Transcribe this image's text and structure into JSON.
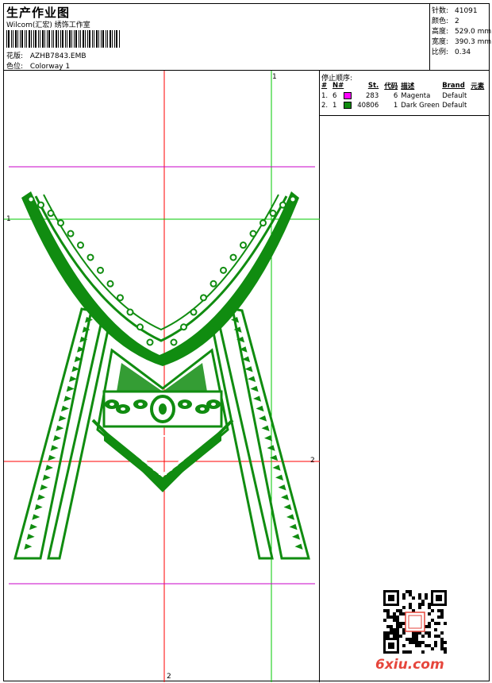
{
  "header": {
    "title": "生产作业图",
    "studio": "Wilcom(汇宏) 绣饰工作室",
    "pattern_label": "花版:",
    "pattern_value": "AZHB7843.EMB",
    "colorway_label": "色位:",
    "colorway_value": "Colorway 1"
  },
  "stats": {
    "stitches_label": "针数:",
    "stitches_value": "41091",
    "colors_label": "颜色:",
    "colors_value": "2",
    "height_label": "高度:",
    "height_value": "529.0 mm",
    "width_label": "宽度:",
    "width_value": "390.3 mm",
    "scale_label": "比例:",
    "scale_value": "0.34"
  },
  "stop_sequence": {
    "title": "停止顺序:",
    "columns": [
      "#",
      "N#",
      "St.",
      "代码",
      "描述",
      "Brand",
      "元素"
    ],
    "rows": [
      {
        "no": "1.",
        "n": "6",
        "color": "#ff00ff",
        "stitches": "283",
        "code": "6",
        "desc": "Magenta",
        "brand": "Default"
      },
      {
        "no": "2.",
        "n": "1",
        "color": "#108c10",
        "stitches": "40806",
        "code": "1",
        "desc": "Dark Green",
        "brand": "Default"
      }
    ]
  },
  "guides": {
    "v1_label": "1",
    "h1_label": "1",
    "h2_label": "2",
    "v2_label": "2"
  },
  "colors": {
    "embroidery": "#108c10",
    "red_guide": "#ff0000",
    "green_guide": "#00c800",
    "magenta_guide": "#c800c8"
  },
  "watermark": "6xiu.com"
}
